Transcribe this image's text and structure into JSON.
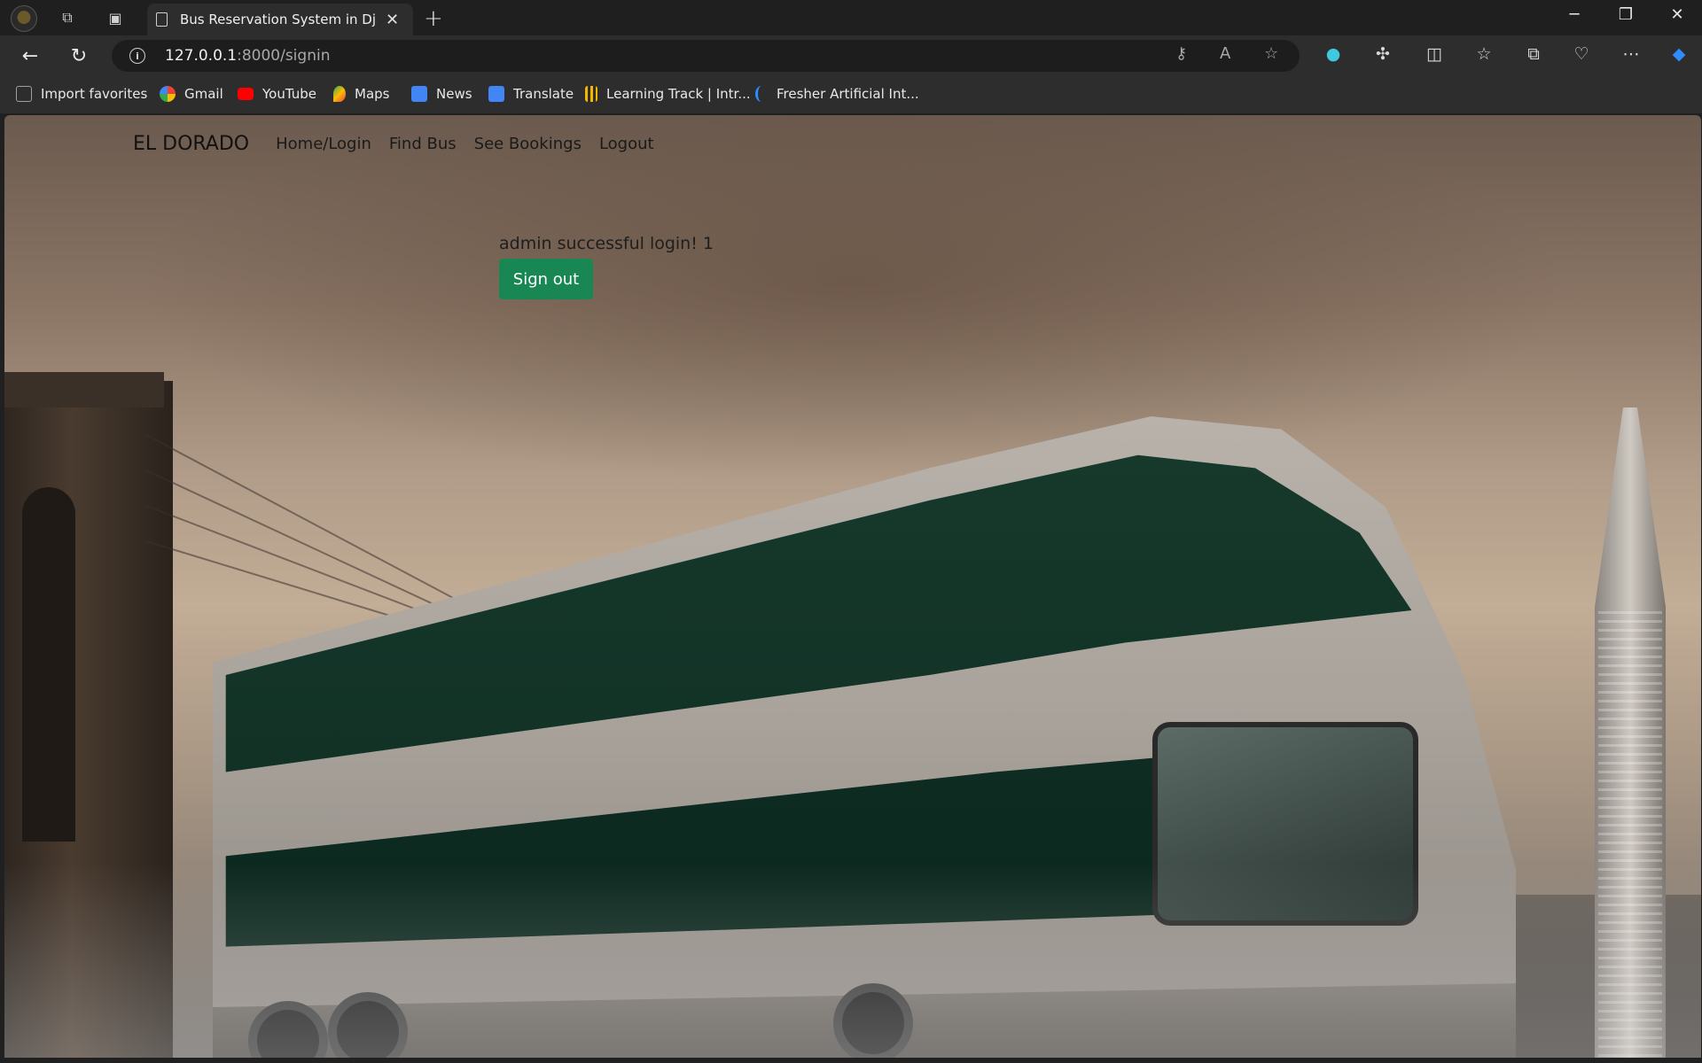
{
  "browser": {
    "tab_title": "Bus Reservation System in Djang",
    "url_host": "127.0.0.1",
    "url_path": ":8000/signin",
    "bookmarks": [
      {
        "label": "Import favorites",
        "color": "#9aa0a6"
      },
      {
        "label": "Gmail",
        "color": "#ea4335"
      },
      {
        "label": "YouTube",
        "color": "#ff0000"
      },
      {
        "label": "Maps",
        "color": "#34a853"
      },
      {
        "label": "News",
        "color": "#4285f4"
      },
      {
        "label": "Translate",
        "color": "#4285f4"
      },
      {
        "label": "Learning Track | Intr...",
        "color": "#f4b400"
      },
      {
        "label": "Fresher Artificial Int...",
        "color": "#2d8cff"
      }
    ]
  },
  "page": {
    "brand": "EL DORADO",
    "nav": [
      "Home/Login",
      "Find Bus",
      "See Bookings",
      "Logout"
    ],
    "login_message": "admin successful login! 1",
    "signout_label": "Sign out",
    "signout_color": "#198754"
  }
}
